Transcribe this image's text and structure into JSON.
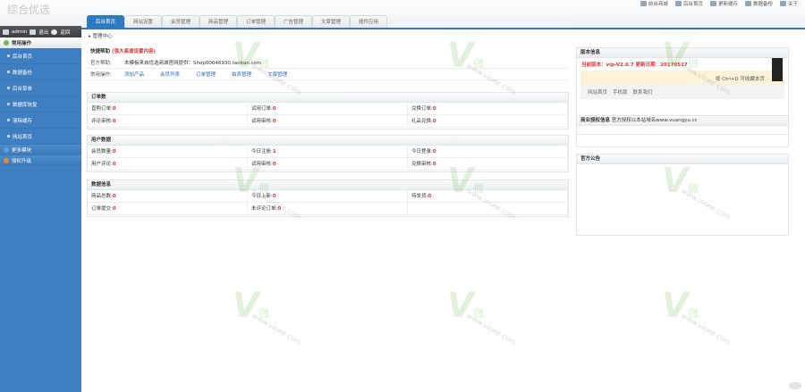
{
  "app": {
    "title": "综合优选"
  },
  "toplinks": [
    "前台商城",
    "后台首页",
    "更新缓存",
    "数据备份",
    "关于"
  ],
  "tabs": [
    "后台首页",
    "网站设置",
    "会员管理",
    "商品管理",
    "订单管理",
    "广告管理",
    "文章管理",
    "插件应用"
  ],
  "user": {
    "name": "admin",
    "btn1": "退出",
    "btn2": "返回"
  },
  "sidebar": {
    "group1": "常用操作",
    "items": [
      "后台首页",
      "数据备份",
      "后台菜单",
      "数据库恢复",
      "清除缓存",
      "网站首页"
    ],
    "group2": "更多模块",
    "group3": "授权升级"
  },
  "breadcrumb": "管理中心",
  "quick": {
    "title": "快捷帮助",
    "title_hint": "(强大高速设置内容)",
    "row1_label": "官方帮助:",
    "row1_text": "本模板来自优选商城官网提供：Shop00646930.taobao.com",
    "row2_label": "常用操作:",
    "row2_links": [
      "添加产品",
      "会员列表",
      "订单管理",
      "拍卖管理",
      "文章管理"
    ]
  },
  "orders": {
    "title": "订单数",
    "cells": [
      {
        "label": "直购订单:",
        "value": "0"
      },
      {
        "label": "试用订单:",
        "value": "0"
      },
      {
        "label": "兑换订单:",
        "value": "0"
      },
      {
        "label": "评论审核:",
        "value": "0"
      },
      {
        "label": "试用审核:",
        "value": "0"
      },
      {
        "label": "礼品兑换:",
        "value": "0"
      }
    ]
  },
  "users": {
    "title": "用户数据",
    "cells": [
      {
        "label": "会员数量:",
        "value": "0"
      },
      {
        "label": "今日注册:",
        "value": "1"
      },
      {
        "label": "今日登录:",
        "value": "0"
      },
      {
        "label": "用户评论:",
        "value": "0"
      },
      {
        "label": "试用审核:",
        "value": "0"
      },
      {
        "label": "兑换审核:",
        "value": "0"
      }
    ]
  },
  "stats": {
    "title": "数据信息",
    "cells": [
      {
        "label": "商品总数:",
        "value": "0"
      },
      {
        "label": "今日上新:",
        "value": "0"
      },
      {
        "label": "待发货:",
        "value": "0"
      },
      {
        "label": "订单提交:",
        "value": "0"
      },
      {
        "label": "未评论订单:",
        "value": "0"
      },
      {
        "label": "",
        "value": ""
      }
    ]
  },
  "version": {
    "title": "版本信息",
    "current": "当前版本：vip-V2.0.7 更新日期：20170517",
    "hint": "按 Ctrl+D 可收藏本页",
    "tabs": [
      "网站首页",
      "手机版",
      "联系我们"
    ]
  },
  "license": {
    "title": "商业授权信息",
    "text": "官方授权以本站域名www.vuangyu.cc"
  },
  "announce": {
    "title": "官方公告"
  },
  "colors": {
    "accent": "#2e7bc0",
    "sidebar": "#3f7fc1",
    "alert": "#dd3333"
  }
}
